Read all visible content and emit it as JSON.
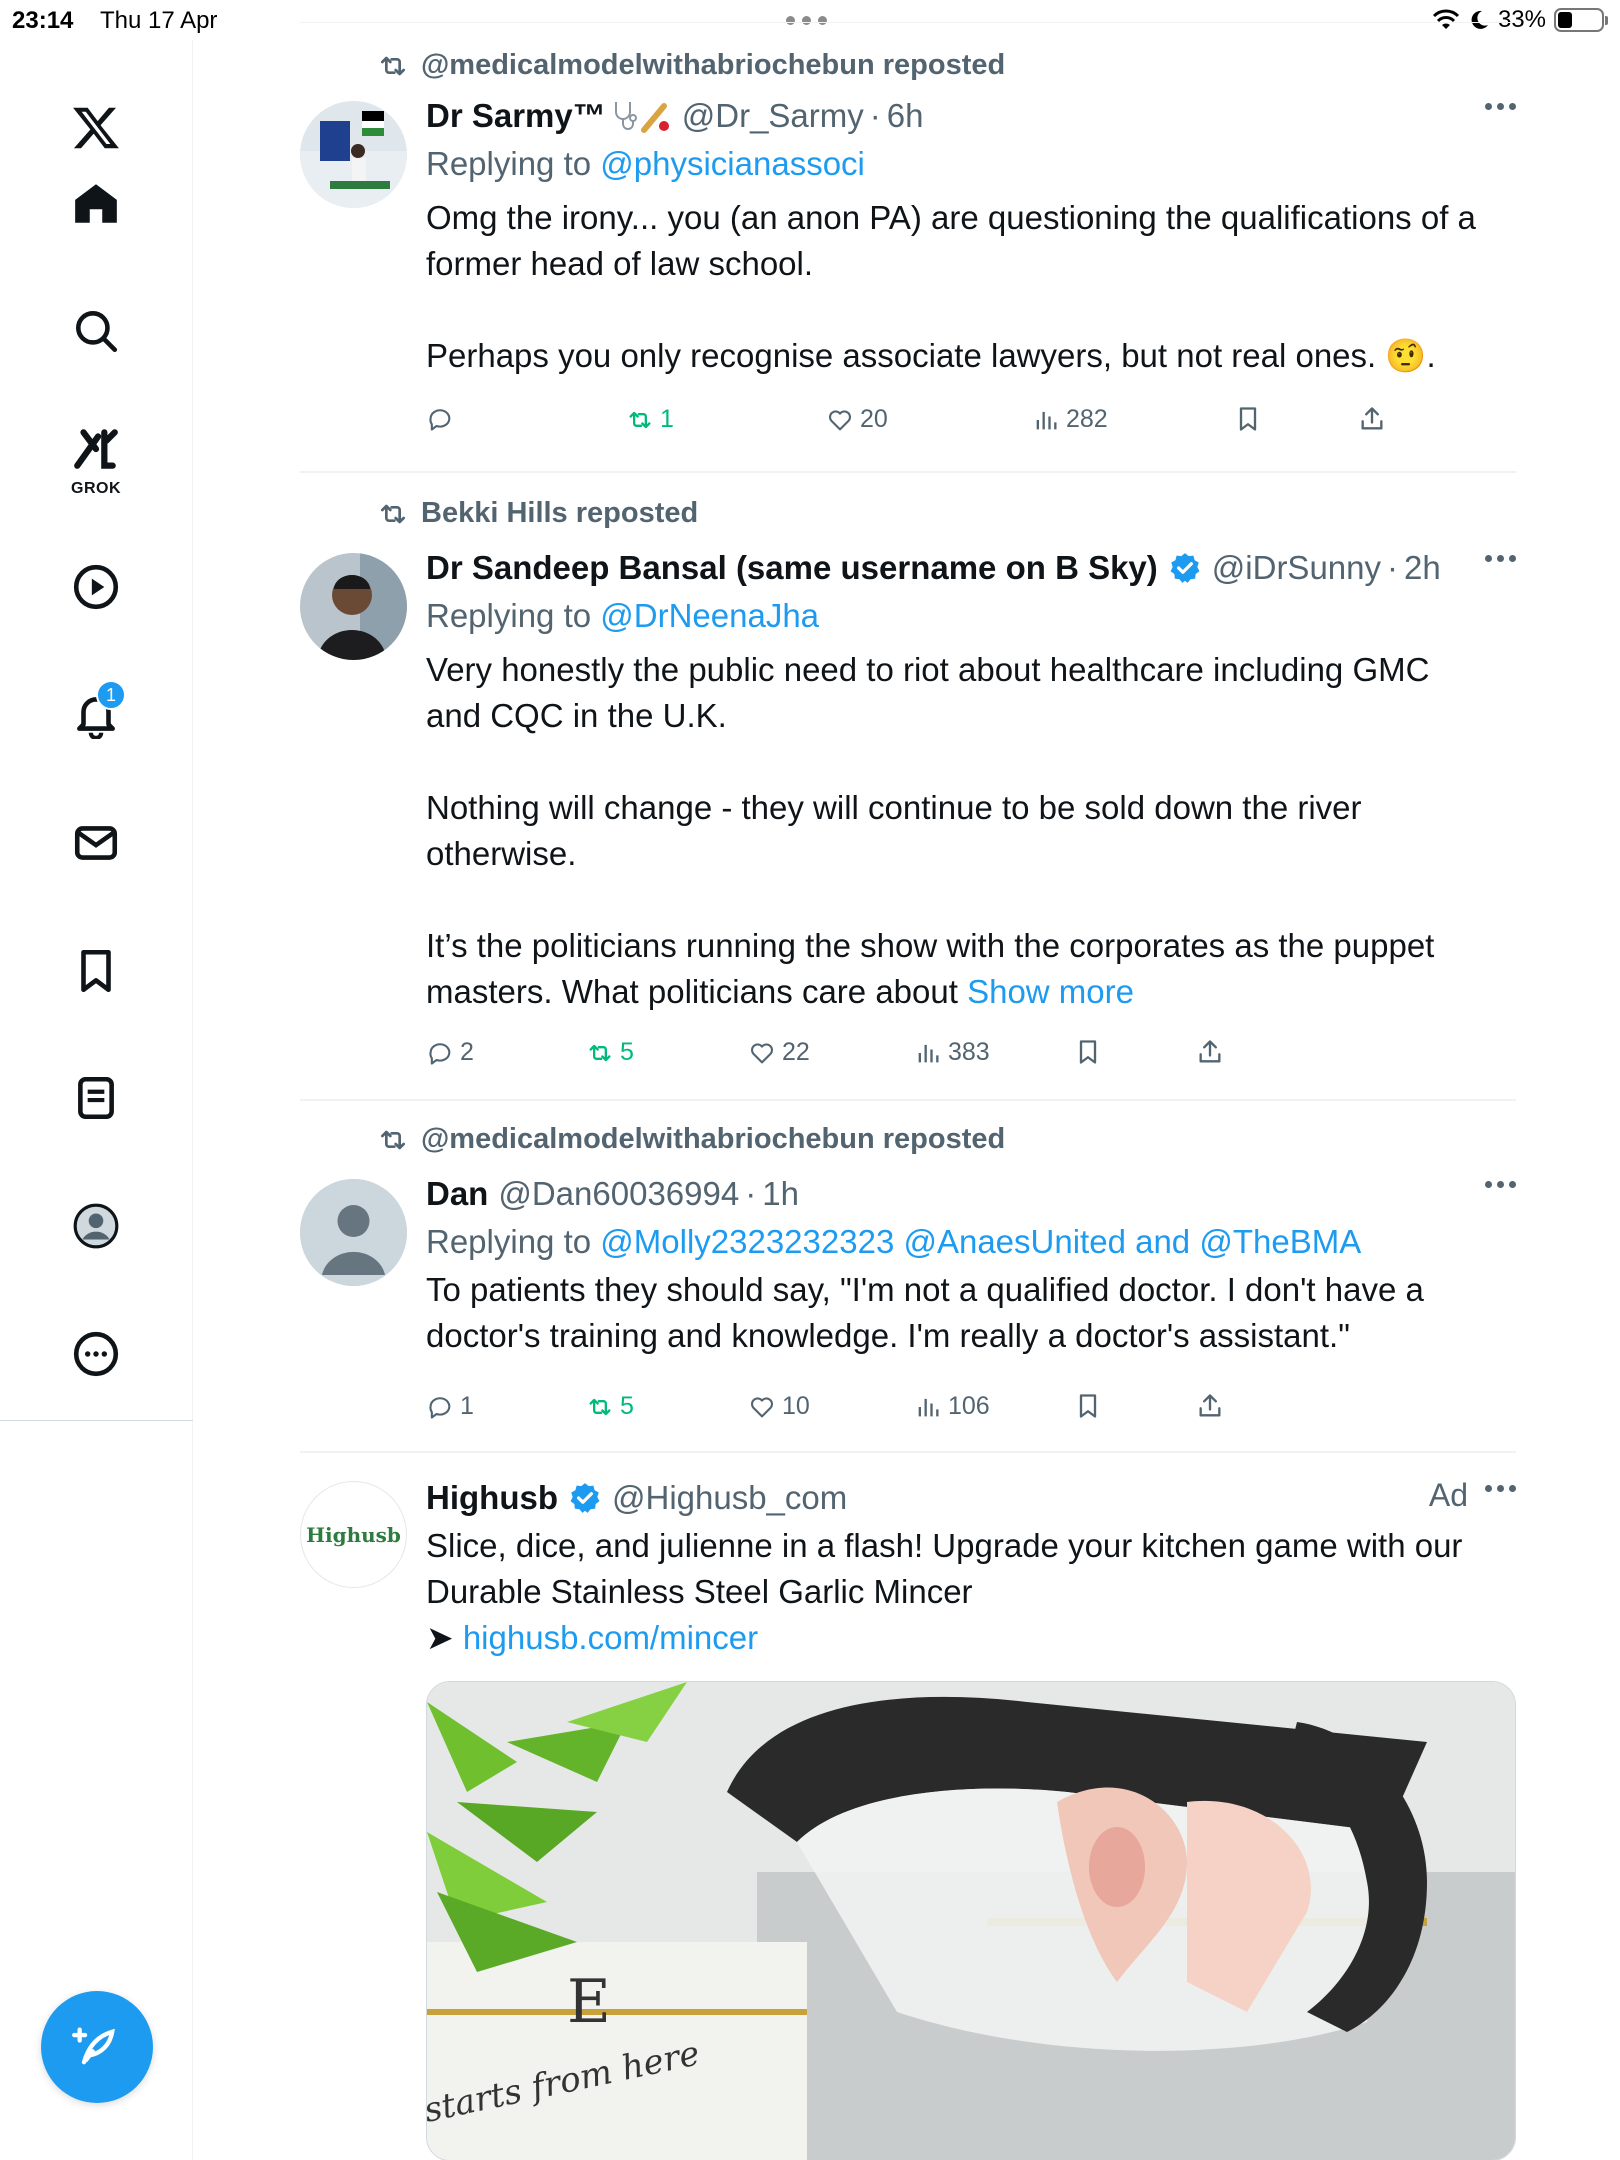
{
  "status_bar": {
    "time": "23:14",
    "date": "Thu 17 Apr",
    "battery": "33%",
    "battery_level": 0.33
  },
  "sidebar": {
    "grok_label": "GROK",
    "notification_count": "1",
    "items": [
      "x-logo",
      "home",
      "explore",
      "grok",
      "video",
      "notifications",
      "messages",
      "bookmarks",
      "lists",
      "profile",
      "more"
    ]
  },
  "colors": {
    "accent": "#1d9bf0",
    "text_primary": "#0f1419",
    "text_secondary": "#536471",
    "repost_green": "#00ba7c"
  },
  "tweets": [
    {
      "repost_by": "@medicalmodelwithabriochebun reposted",
      "name": "Dr Sarmy™",
      "handle": "@Dr_Sarmy",
      "time": "6h",
      "replying_label": "Replying to ",
      "replying_to": "@physicianassoci",
      "text": "Omg the irony... you (an anon PA) are questioning the qualifications of a\nformer head of law school.\n\nPerhaps you only recognise associate lawyers, but not real ones. 🤨.",
      "replies": "",
      "reposts": "1",
      "likes": "20",
      "views": "282"
    },
    {
      "repost_by": "Bekki Hills reposted",
      "name": "Dr Sandeep Bansal (same username on B Sky)",
      "handle": "@iDrSunny",
      "time": "2h",
      "replying_label": "Replying to ",
      "replying_to": "@DrNeenaJha",
      "text": "Very honestly the public need to riot about healthcare including GMC\nand CQC in the U.K.\n\nNothing will change - they will continue to be sold down the river\notherwise.\n\nIt’s the politicians running the show with the corporates as the puppet\nmasters. What politicians care about ",
      "show_more": "Show more",
      "replies": "2",
      "reposts": "5",
      "likes": "22",
      "views": "383"
    },
    {
      "repost_by": "@medicalmodelwithabriochebun reposted",
      "name": "Dan",
      "handle": "@Dan60036994",
      "time": "1h",
      "replying_label": "Replying to ",
      "replying_to": "@Molly2323232323 @AnaesUnited and @TheBMA",
      "text": "To patients they should say, \"I'm not a qualified doctor. I don't have a\ndoctor's training and knowledge. I'm really a doctor's assistant.\"",
      "replies": "1",
      "reposts": "5",
      "likes": "10",
      "views": "106"
    },
    {
      "name": "Highusb",
      "handle": "@Highusb_com",
      "ad_label": "Ad",
      "avatar_text": "Highusb",
      "text": "Slice, dice, and julienne in a flash! Upgrade your kitchen game with our\nDurable Stainless Steel Garlic Mincer",
      "link_arrow": "➤ ",
      "link": "highusb.com/mincer",
      "media_caption": "starts from here"
    }
  ]
}
